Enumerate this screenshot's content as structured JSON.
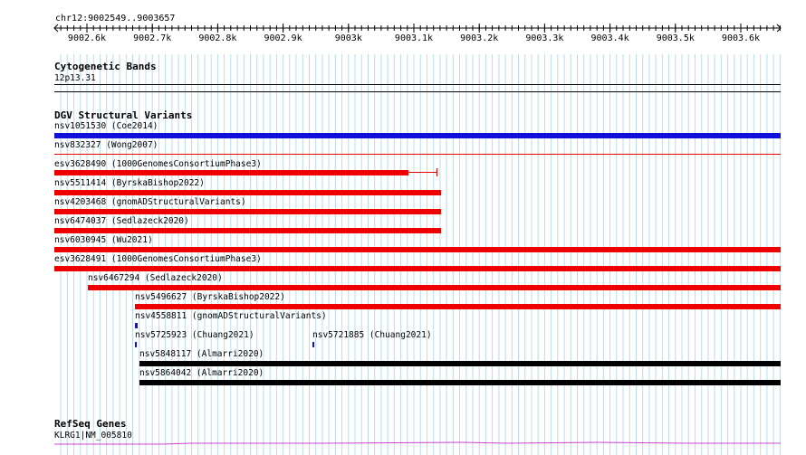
{
  "ruler": {
    "position": "chr12:9002549..9003657",
    "ticks": [
      "9002.6k",
      "9002.7k",
      "9002.8k",
      "9002.9k",
      "9003k",
      "9003.1k",
      "9003.2k",
      "9003.3k",
      "9003.4k",
      "9003.5k",
      "9003.6k"
    ]
  },
  "cytoband": {
    "title": "Cytogenetic Bands",
    "band": "12p13.31"
  },
  "dgv": {
    "title": "DGV Structural Variants",
    "colors": {
      "gain": "#1010dd",
      "loss": "#ee0000",
      "complex": "#000000"
    },
    "features": [
      {
        "label": "nsv1051530 (Coe2014)",
        "color": "blue"
      },
      {
        "label": "nsv832327 (Wong2007)",
        "color": "red"
      },
      {
        "label": "esv3628490 (1000GenomesConsortiumPhase3)",
        "color": "red"
      },
      {
        "label": "nsv5511414 (ByrskaBishop2022)",
        "color": "red"
      },
      {
        "label": "nsv4203468 (gnomADStructuralVariants)",
        "color": "red"
      },
      {
        "label": "nsv6474037 (Sedlazeck2020)",
        "color": "red"
      },
      {
        "label": "nsv6030945 (Wu2021)",
        "color": "red"
      },
      {
        "label": "esv3628491 (1000GenomesConsortiumPhase3)",
        "color": "red"
      },
      {
        "label": "nsv6467294 (Sedlazeck2020)",
        "color": "red"
      },
      {
        "label": "nsv5496627 (ByrskaBishop2022)",
        "color": "red"
      },
      {
        "label": "nsv4558811 (gnomADStructuralVariants)",
        "color": "blue"
      },
      {
        "label": "nsv5725923 (Chuang2021)",
        "color": "blue"
      },
      {
        "label": "nsv5721885 (Chuang2021)",
        "color": "blue"
      },
      {
        "label": "nsv5848117 (Almarri2020)",
        "color": "black"
      },
      {
        "label": "nsv5864042 (Almarri2020)",
        "color": "black"
      }
    ]
  },
  "refseq": {
    "title": "RefSeq Genes",
    "gene": "KLRG1|NM_005810",
    "color": "#cc44cc"
  }
}
